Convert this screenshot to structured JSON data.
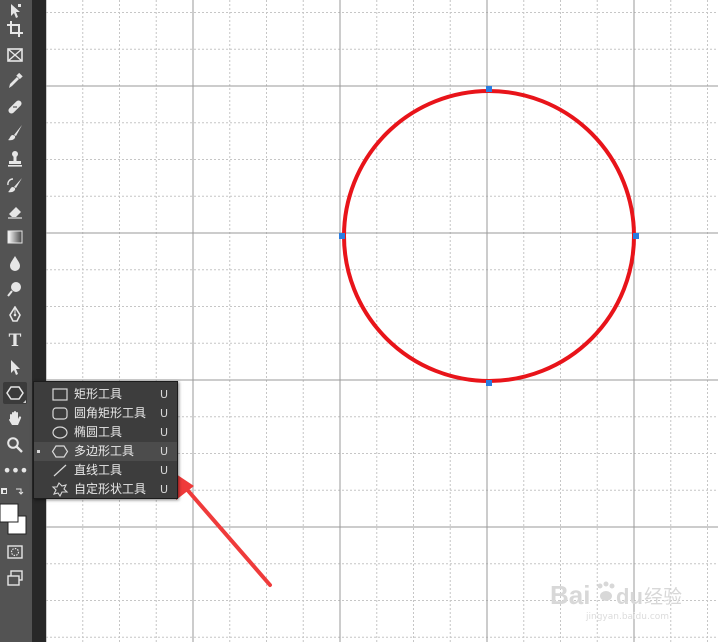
{
  "toolbar": {
    "tools": [
      {
        "name": "move-tool"
      },
      {
        "name": "crop-tool"
      },
      {
        "name": "frame-tool"
      },
      {
        "name": "eyedropper-tool"
      },
      {
        "name": "healing-brush-tool"
      },
      {
        "name": "brush-tool"
      },
      {
        "name": "clone-stamp-tool"
      },
      {
        "name": "history-brush-tool"
      },
      {
        "name": "eraser-tool"
      },
      {
        "name": "gradient-tool"
      },
      {
        "name": "blur-tool"
      },
      {
        "name": "dodge-tool"
      },
      {
        "name": "pen-tool"
      },
      {
        "name": "type-tool",
        "glyph": "T"
      },
      {
        "name": "path-selection-tool"
      },
      {
        "name": "polygon-shape-tool"
      },
      {
        "name": "hand-tool"
      },
      {
        "name": "zoom-tool"
      },
      {
        "name": "edit-toolbar",
        "glyph": "•••"
      }
    ]
  },
  "shape_menu": {
    "items": [
      {
        "icon": "rectangle-icon",
        "label": "矩形工具",
        "shortcut": "U",
        "selected": false
      },
      {
        "icon": "rounded-rectangle-icon",
        "label": "圆角矩形工具",
        "shortcut": "U",
        "selected": false
      },
      {
        "icon": "ellipse-icon",
        "label": "椭圆工具",
        "shortcut": "U",
        "selected": false
      },
      {
        "icon": "polygon-icon",
        "label": "多边形工具",
        "shortcut": "U",
        "selected": true
      },
      {
        "icon": "line-icon",
        "label": "直线工具",
        "shortcut": "U",
        "selected": false
      },
      {
        "icon": "custom-shape-icon",
        "label": "自定形状工具",
        "shortcut": "U",
        "selected": false
      }
    ]
  },
  "colors": {
    "foreground": "#ffffff",
    "background": "#ffffff",
    "circle_stroke": "#e8141a",
    "path_outline": "#3f6fc4",
    "anchor": "#2a7de1",
    "arrow": "#ef3b3b",
    "toolbar_bg": "#535353",
    "menu_bg": "#3d3d3d"
  },
  "watermark": {
    "brand": "Bai",
    "brand_tail": "du",
    "label": "经验",
    "sub": "jingyan.baidu.com"
  }
}
